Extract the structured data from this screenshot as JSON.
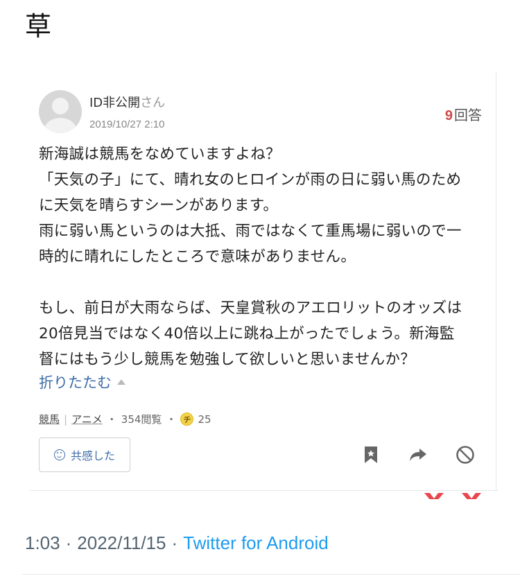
{
  "tweet": {
    "text": "草",
    "time": "1:03",
    "date": "2022/11/15",
    "dot": "·",
    "app": "Twitter for Android"
  },
  "card": {
    "user": {
      "name": "ID非公開",
      "suffix": "さん"
    },
    "date": "2019/10/27 2:10",
    "answers": {
      "count": "9",
      "label": "回答"
    },
    "question_paragraphs": [
      "新海誠は競馬をなめていますよね？「天気の子」にて、晴れ女のヒロインが雨の日に弱い馬のために天気を晴らすシーンがあります。雨に弱い馬というのは大抵、雨ではなくて重馬場に弱いので一時的に晴れにしたところで意味がありません。",
      "もし、前日が大雨ならば、天皇賞秋のアエロリットのオッズは20倍見当ではなく40倍以上に跳ね上がったでしょう。新海監督にはもう少し競馬を勉強して欲しいと思いませんか？"
    ],
    "question_lines_1": [
      "新海誠は競馬をなめていますよね？",
      "「天気の子」にて、晴れ女のヒロインが雨の日に弱い馬のため",
      "に天気を晴らすシーンがあります。",
      "雨に弱い馬というのは大抵、雨ではなくて重馬場に弱いので一",
      "時的に晴れにしたところで意味がありません。"
    ],
    "question_lines_2": [
      "もし、前日が大雨ならば、天皇賞秋のアエロリットのオッズは",
      "20倍見当ではなく40倍以上に跳ね上がったでしょう。新海監",
      "督にはもう少し競馬を勉強して欲しいと思いませんか？"
    ],
    "collapse_label": "折りたたむ",
    "tags": [
      "競馬",
      "アニメ"
    ],
    "tag_sep": "|",
    "views": "354閲覧",
    "bullet": "・",
    "coin_glyph": "チ",
    "coins": "25",
    "agree_label": "共感した"
  },
  "colors": {
    "link_blue": "#3c6ca8",
    "answer_red": "#d04747",
    "twitter_blue": "#1d9bf0",
    "meta_gray": "#536471"
  },
  "icons": [
    "bookmark-icon",
    "share-arrow-icon",
    "block-icon",
    "smile-icon",
    "coin-icon",
    "avatar-icon"
  ]
}
